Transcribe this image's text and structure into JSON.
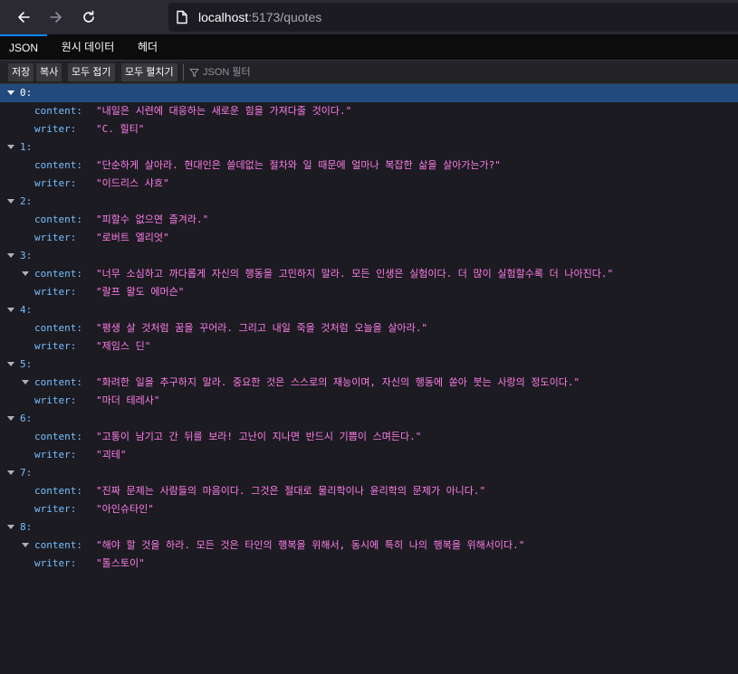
{
  "browser": {
    "url_host": "localhost",
    "url_path": ":5173/quotes"
  },
  "viewer_tabs": [
    "JSON",
    "원시 데이터",
    "헤더"
  ],
  "toolbar": {
    "save": "저장",
    "copy": "복사",
    "collapse_all": "모두 접기",
    "expand_all": "모두 펼치기",
    "filter_placeholder": "JSON 필터"
  },
  "quotes": [
    {
      "index": "0:",
      "content": "\"내일은 시련에 대응하는 새로운 힘을 가져다줄 것이다.\"",
      "writer": "\"C. 힐티\""
    },
    {
      "index": "1:",
      "content": "\"단순하게 살아라. 현대인은 쓸데없는 절차와 일 때문에 얼마나 복잡한 삶을 살아가는가?\"",
      "writer": "\"이드리스 샤흐\""
    },
    {
      "index": "2:",
      "content": "\"피할수 없으면 즐겨라.\"",
      "writer": "\"로버트 엘리엇\""
    },
    {
      "index": "3:",
      "content": "\"너무 소심하고 까다롭게 자신의 행동을 고민하지 말라. 모든 인생은 실험이다. 더 많이 실험할수록 더 나아진다.\"",
      "writer": "\"랄프 왈도 에머슨\""
    },
    {
      "index": "4:",
      "content": "\"평생 살 것처럼 꿈을 꾸어라. 그리고 내일 죽을 것처럼 오늘을 살아라.\"",
      "writer": "\"제임스 딘\""
    },
    {
      "index": "5:",
      "content": "\"화려한 일을 추구하지 말라. 중요한 것은 스스로의 재능이며, 자신의 행동에 쏟아 붓는 사랑의 정도이다.\"",
      "writer": "\"마더 테레사\""
    },
    {
      "index": "6:",
      "content": "\"고통이 남기고 간 뒤를 보라! 고난이 지나면 반드시 기쁨이 스며든다.\"",
      "writer": "\"괴테\""
    },
    {
      "index": "7:",
      "content": "\"진짜 문제는 사람들의 마음이다. 그것은 절대로 물리학이나 윤리학의 문제가 아니다.\"",
      "writer": "\"아인슈타인\""
    },
    {
      "index": "8:",
      "content": "\"해야 할 것을 하라. 모든 것은 타인의 행복을 위해서, 동시에 특히 나의 행복을 위해서이다.\"",
      "writer": "\"톨스토이\""
    }
  ],
  "labels": {
    "content_key": "content:",
    "writer_key": "writer:"
  },
  "colors": {
    "key": "#75bfff",
    "string": "#ff7de9",
    "selected_row": "#234a7d",
    "tab_accent": "#0a84ff"
  }
}
